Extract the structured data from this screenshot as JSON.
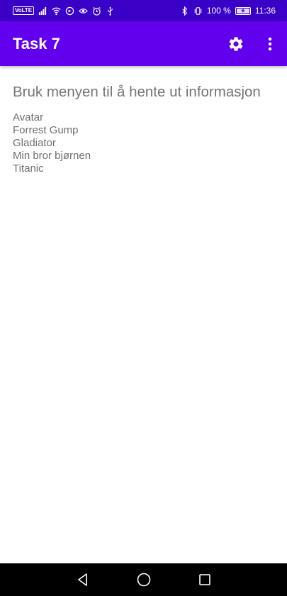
{
  "status_bar": {
    "volte_label": "VoLTE",
    "battery_percent_text": "100 %",
    "battery_level": 1.0,
    "time": "11:36",
    "background_color": "#3a00c8"
  },
  "app_bar": {
    "title": "Task 7",
    "actions": [
      "gear-icon",
      "more-vert-icon"
    ],
    "background_color": "#6200ee"
  },
  "main": {
    "heading": "Bruk menyen til å hente ut informasjon",
    "movies": [
      "Avatar",
      "Forrest Gump",
      "Gladiator",
      "Min bror bjørnen",
      "Titanic"
    ]
  },
  "nav_bar": {
    "buttons": [
      "back-triangle-icon",
      "home-circle-icon",
      "recents-square-icon"
    ]
  }
}
